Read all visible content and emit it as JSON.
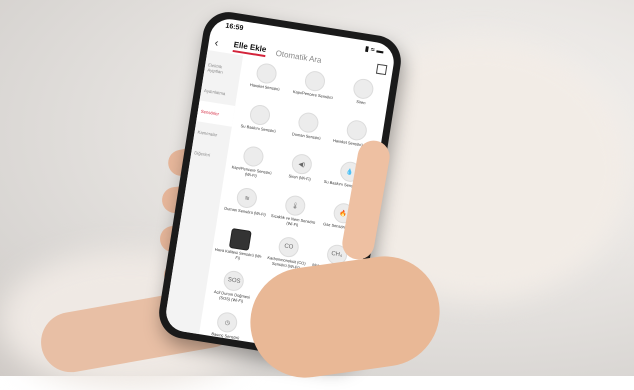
{
  "status": {
    "time": "16:59",
    "icons": "▮ ≈ ▬"
  },
  "nav": {
    "back": "‹",
    "tab_active": "Elle Ekle",
    "tab_inactive": "Otomatik Ara"
  },
  "categories": [
    {
      "label": "Elektrik Aygıtları",
      "selected": false
    },
    {
      "label": "Aydınlatma",
      "selected": false
    },
    {
      "label": "Sensörler",
      "selected": true
    },
    {
      "label": "Kameralar",
      "selected": false
    },
    {
      "label": "Diğerleri",
      "selected": false
    }
  ],
  "devices": [
    {
      "label": "Hareket Sensörü",
      "icon": ""
    },
    {
      "label": "Kapı/Pencere Sensörü",
      "icon": ""
    },
    {
      "label": "Siren",
      "icon": ""
    },
    {
      "label": "Su Baskını Sensörü",
      "icon": ""
    },
    {
      "label": "Duman Sensörü",
      "icon": ""
    },
    {
      "label": "Hareket Sensörü (Wi-Fi)",
      "icon": ""
    },
    {
      "label": "Kapı/Pencere Sensörü (Wi-Fi)",
      "icon": ""
    },
    {
      "label": "Siren (Wi-Fi)",
      "icon": "◀)"
    },
    {
      "label": "Su Baskını Sensörü (Wi-Fi)",
      "icon": "💧"
    },
    {
      "label": "Duman Sensörü (Wi-Fi)",
      "icon": "≋"
    },
    {
      "label": "Sıcaklık ve Nem Sensörü (Wi-Fi)",
      "icon": "🌡"
    },
    {
      "label": "Gaz Sensörü (Wi-Fi)",
      "icon": "🔥"
    },
    {
      "label": "Hava Kalitesi Sensörü (Wi-Fi)",
      "icon": ""
    },
    {
      "label": "Karbonmonoksit (CO) Sensörü (Wi-Fi)",
      "icon": "CO"
    },
    {
      "label": "Metan Gazı Sensörü (Wi-Fi)",
      "icon": "CH₄"
    },
    {
      "label": "Acil Durum Düğmesi (SOS) (Wi-Fi)",
      "icon": "SOS"
    },
    {
      "label": "Alarm (Wi-Fi)",
      "icon": ""
    },
    {
      "label": "Işık Sensörü (Wi-Fi)",
      "icon": "☀"
    },
    {
      "label": "Basınç Sensörü",
      "icon": "◷"
    },
    {
      "label": "Titreşim Sensörü",
      "icon": "〰"
    },
    {
      "label": "Toprak Nem Sensörü",
      "icon": "▯"
    }
  ]
}
